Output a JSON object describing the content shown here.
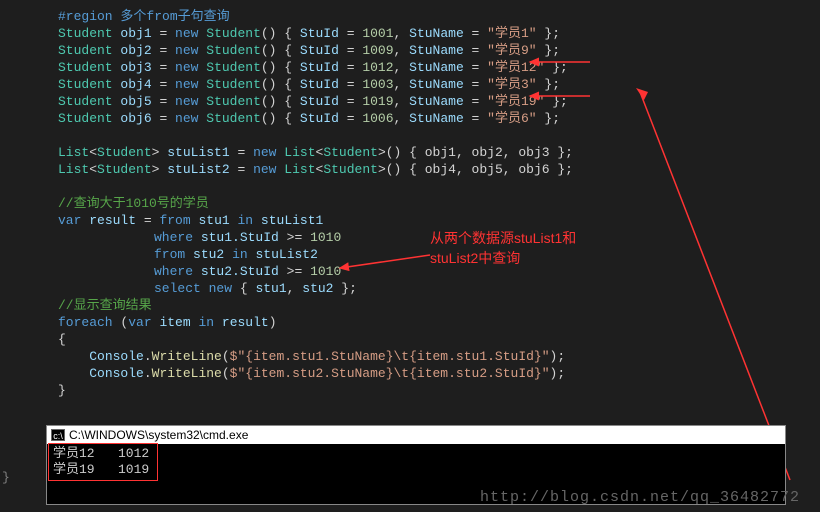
{
  "code": {
    "region": "#region 多个from子句查询",
    "obj1": {
      "id": "1001",
      "name": "学员1"
    },
    "obj2": {
      "id": "1009",
      "name": "学员9"
    },
    "obj3": {
      "id": "1012",
      "name": "学员12"
    },
    "obj4": {
      "id": "1003",
      "name": "学员3"
    },
    "obj5": {
      "id": "1019",
      "name": "学员19"
    },
    "obj6": {
      "id": "1006",
      "name": "学员6"
    },
    "list1": "stuList1",
    "list1Items": "obj1, obj2, obj3",
    "list2": "stuList2",
    "list2Items": "obj4, obj5, obj6",
    "comment1": "//查询大于1010号的学员",
    "whereVal": "1010",
    "comment2": "//显示查询结果",
    "writeLine1": "Console.WriteLine($\"{item.stu1.StuName}\\t{item.stu1.StuId}\");",
    "writeLine2": "Console.WriteLine($\"{item.stu2.StuName}\\t{item.stu2.StuId}\");"
  },
  "annotation": {
    "line1": "从两个数据源stuList1和",
    "line2": "stuList2中查询"
  },
  "console": {
    "title": "C:\\WINDOWS\\system32\\cmd.exe",
    "rows": [
      "学员12   1012",
      "学员19   1019"
    ]
  },
  "watermark": "http://blog.csdn.net/qq_36482772"
}
